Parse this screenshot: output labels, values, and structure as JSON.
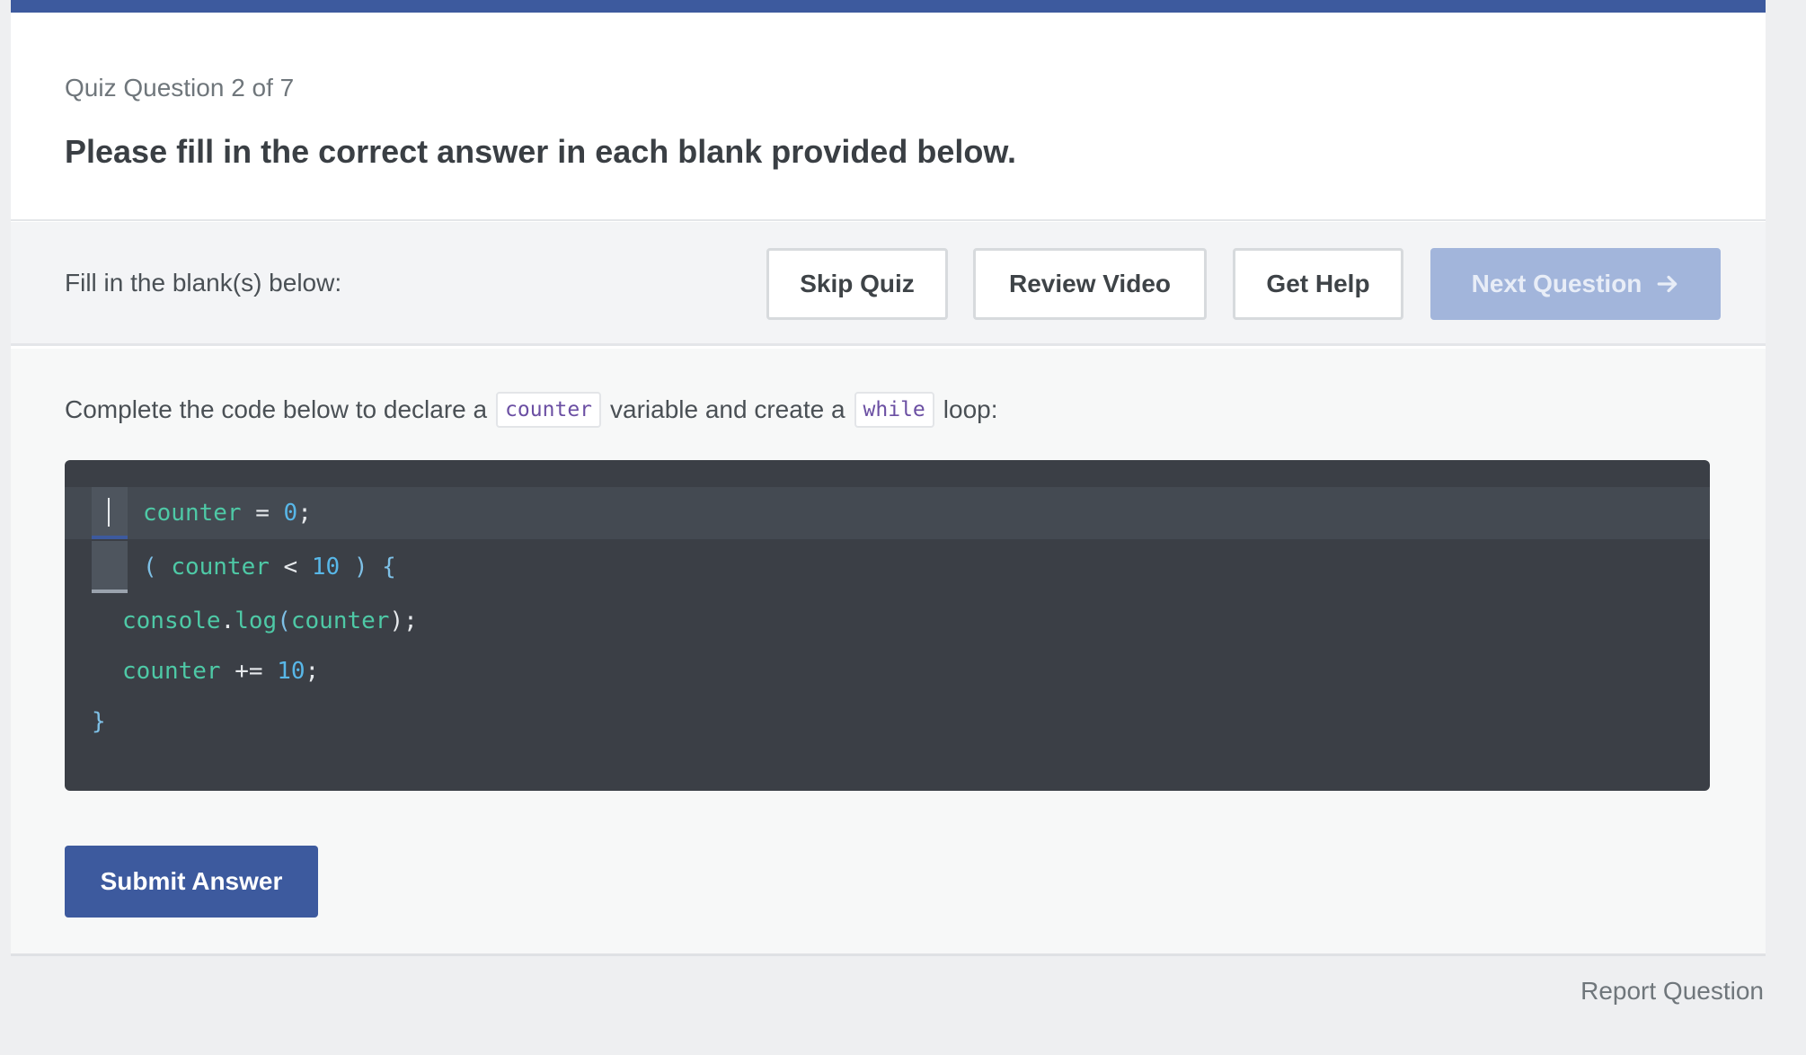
{
  "quiz": {
    "counter_text": "Quiz Question 2 of 7",
    "title": "Please fill in the correct answer in each blank provided below."
  },
  "toolbar": {
    "label": "Fill in the blank(s) below:",
    "skip_label": "Skip Quiz",
    "review_label": "Review Video",
    "help_label": "Get Help",
    "next_label": "Next Question"
  },
  "prompt": {
    "text_before": "Complete the code below to declare a",
    "code1": "counter",
    "text_middle": "variable and create a",
    "code2": "while",
    "text_after": "loop:"
  },
  "code": {
    "line1": {
      "var": "counter",
      "op": " = ",
      "num": "0",
      "end": ";"
    },
    "line2": {
      "open": "( ",
      "var": "counter",
      "op": " < ",
      "num": "10",
      "close": " ) {"
    },
    "line3": {
      "obj": "console",
      "dot": ".",
      "method": "log",
      "open": "(",
      "arg": "counter",
      "close": ");"
    },
    "line4": {
      "var": "counter",
      "op": " += ",
      "num": "10",
      "end": ";"
    },
    "line5": {
      "brace": "}"
    }
  },
  "actions": {
    "submit_label": "Submit Answer",
    "report_label": "Report Question"
  },
  "colors": {
    "accent": "#3d5a9e",
    "next_disabled": "#a2b5db",
    "editor_bg": "#3b3f46"
  }
}
